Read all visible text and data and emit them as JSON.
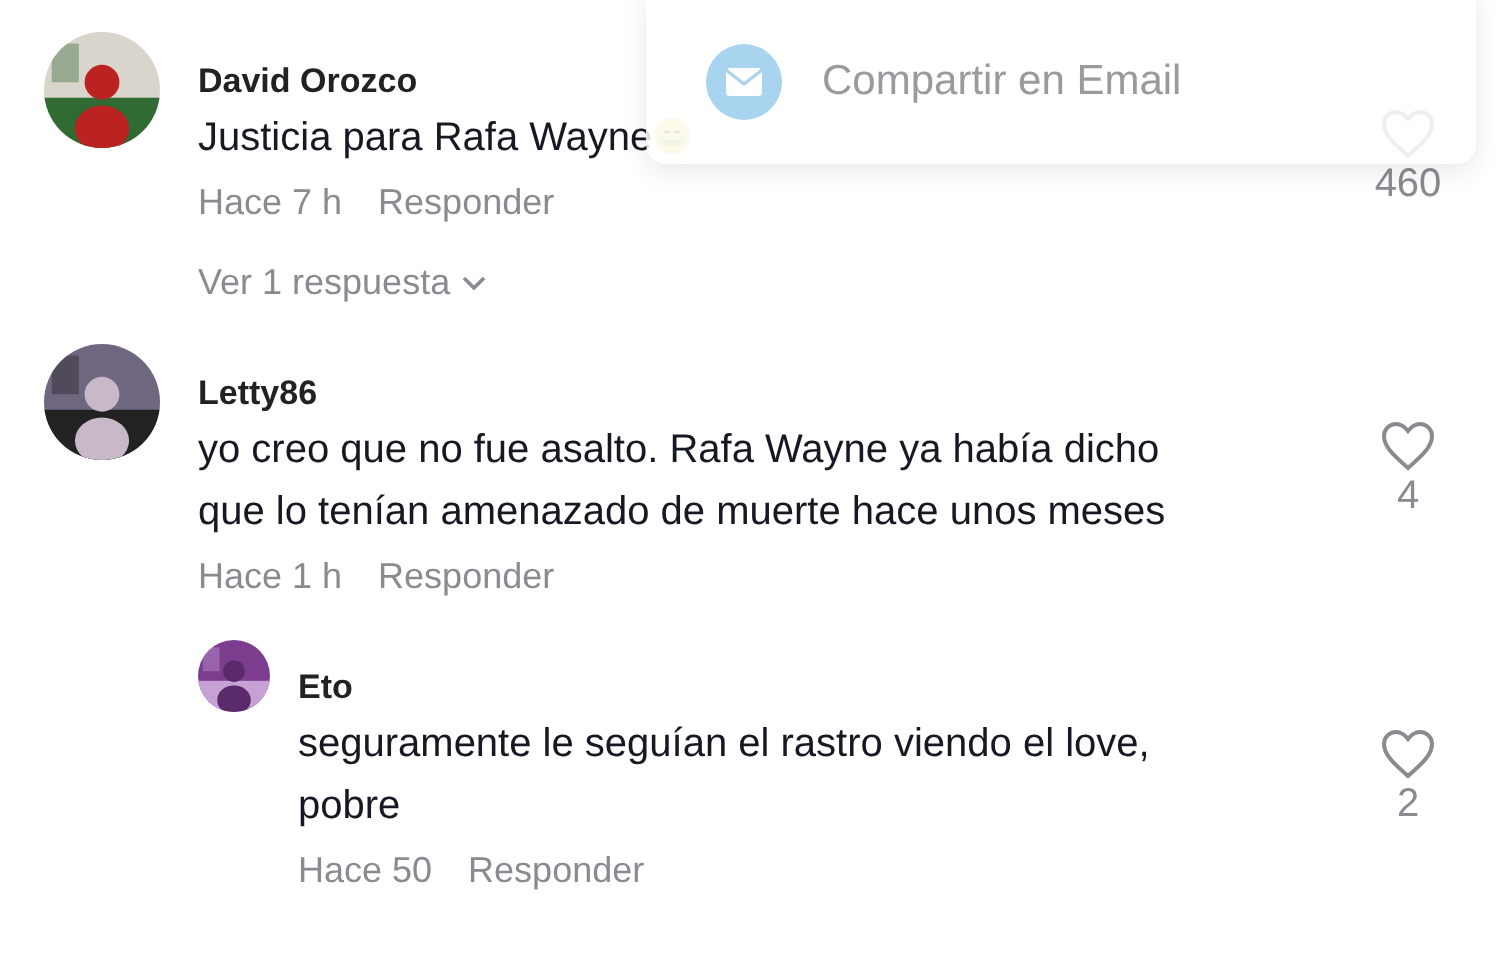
{
  "share_menu": {
    "label": "Compartir en Email"
  },
  "comments": [
    {
      "author": "David Orozco",
      "text": "Justicia para Rafa Wayne",
      "emoji": true,
      "time": "Hace 7 h",
      "reply": "Responder",
      "likes": "460",
      "avatar": {
        "kind": "picture"
      },
      "more_replies": "Ver 1 respuesta"
    },
    {
      "author": "Letty86",
      "text": "yo creo que no fue asalto. Rafa Wayne ya había dicho que lo tenían amenazado de muerte hace unos meses",
      "emoji": false,
      "time": "Hace 1 h",
      "reply": "Responder",
      "likes": "4",
      "avatar": {
        "kind": "picture"
      },
      "replies": [
        {
          "author": "Eto",
          "text": "seguramente le seguían el rastro viendo el love, pobre",
          "emoji": false,
          "time": "Hace 50",
          "reply": "Responder",
          "likes": "2",
          "avatar": {
            "kind": "picture"
          }
        }
      ]
    }
  ]
}
